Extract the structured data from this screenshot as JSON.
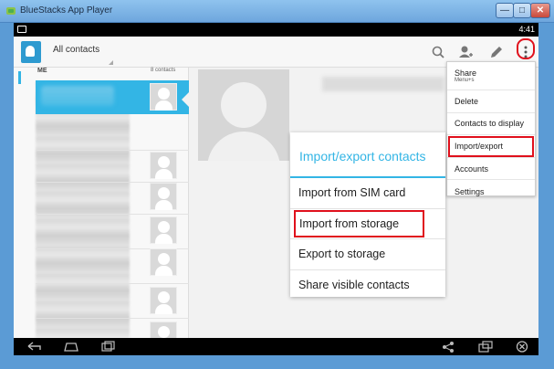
{
  "window": {
    "title": "BlueStacks App Player",
    "minimize_label": "—",
    "maximize_label": "□",
    "close_label": "✕"
  },
  "status_bar": {
    "time": "4:41"
  },
  "action_bar": {
    "title": "All contacts",
    "icons": [
      "search-icon",
      "add-contact-icon",
      "edit-icon",
      "overflow-menu-icon"
    ]
  },
  "contacts_list": {
    "section_label": "ME",
    "count_label": "8 contacts"
  },
  "overflow_menu": {
    "items": [
      {
        "label": "Share",
        "sub": "Menu+s"
      },
      {
        "label": "Delete"
      },
      {
        "label": "Contacts to display"
      },
      {
        "label": "Import/export"
      },
      {
        "label": "Accounts"
      },
      {
        "label": "Settings"
      }
    ]
  },
  "import_export_dialog": {
    "title": "Import/export contacts",
    "items": [
      {
        "label": "Import from SIM card"
      },
      {
        "label": "Import from storage"
      },
      {
        "label": "Export to storage"
      },
      {
        "label": "Share visible contacts"
      }
    ]
  },
  "colors": {
    "accent": "#33b5e5",
    "highlight": "#e0101c",
    "frame": "#5b9bd5"
  },
  "nav_bar": {
    "icons": [
      "back-icon",
      "home-icon",
      "recents-icon",
      "share-icon",
      "window-toggle-icon",
      "close-app-icon"
    ]
  }
}
